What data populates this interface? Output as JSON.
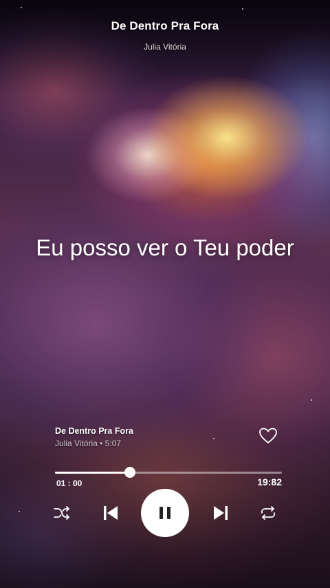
{
  "header": {
    "song_title": "De Dentro Pra Fora",
    "artist": "Julia Vitória"
  },
  "lyrics": {
    "current_line": "Eu posso ver o Teu poder"
  },
  "now_playing": {
    "title": "De Dentro Pra Fora",
    "subtitle": "Julia Vitória • 5:07",
    "liked": false
  },
  "progress": {
    "elapsed": "01 : 00",
    "total": "19:82",
    "fraction": 0.33
  },
  "controls": {
    "shuffle_icon": "shuffle-icon",
    "previous_icon": "skip-previous-icon",
    "play_pause_icon": "pause-icon",
    "next_icon": "skip-next-icon",
    "repeat_icon": "repeat-icon"
  },
  "colors": {
    "accent": "#ffffff",
    "play_button_icon": "#222222"
  }
}
